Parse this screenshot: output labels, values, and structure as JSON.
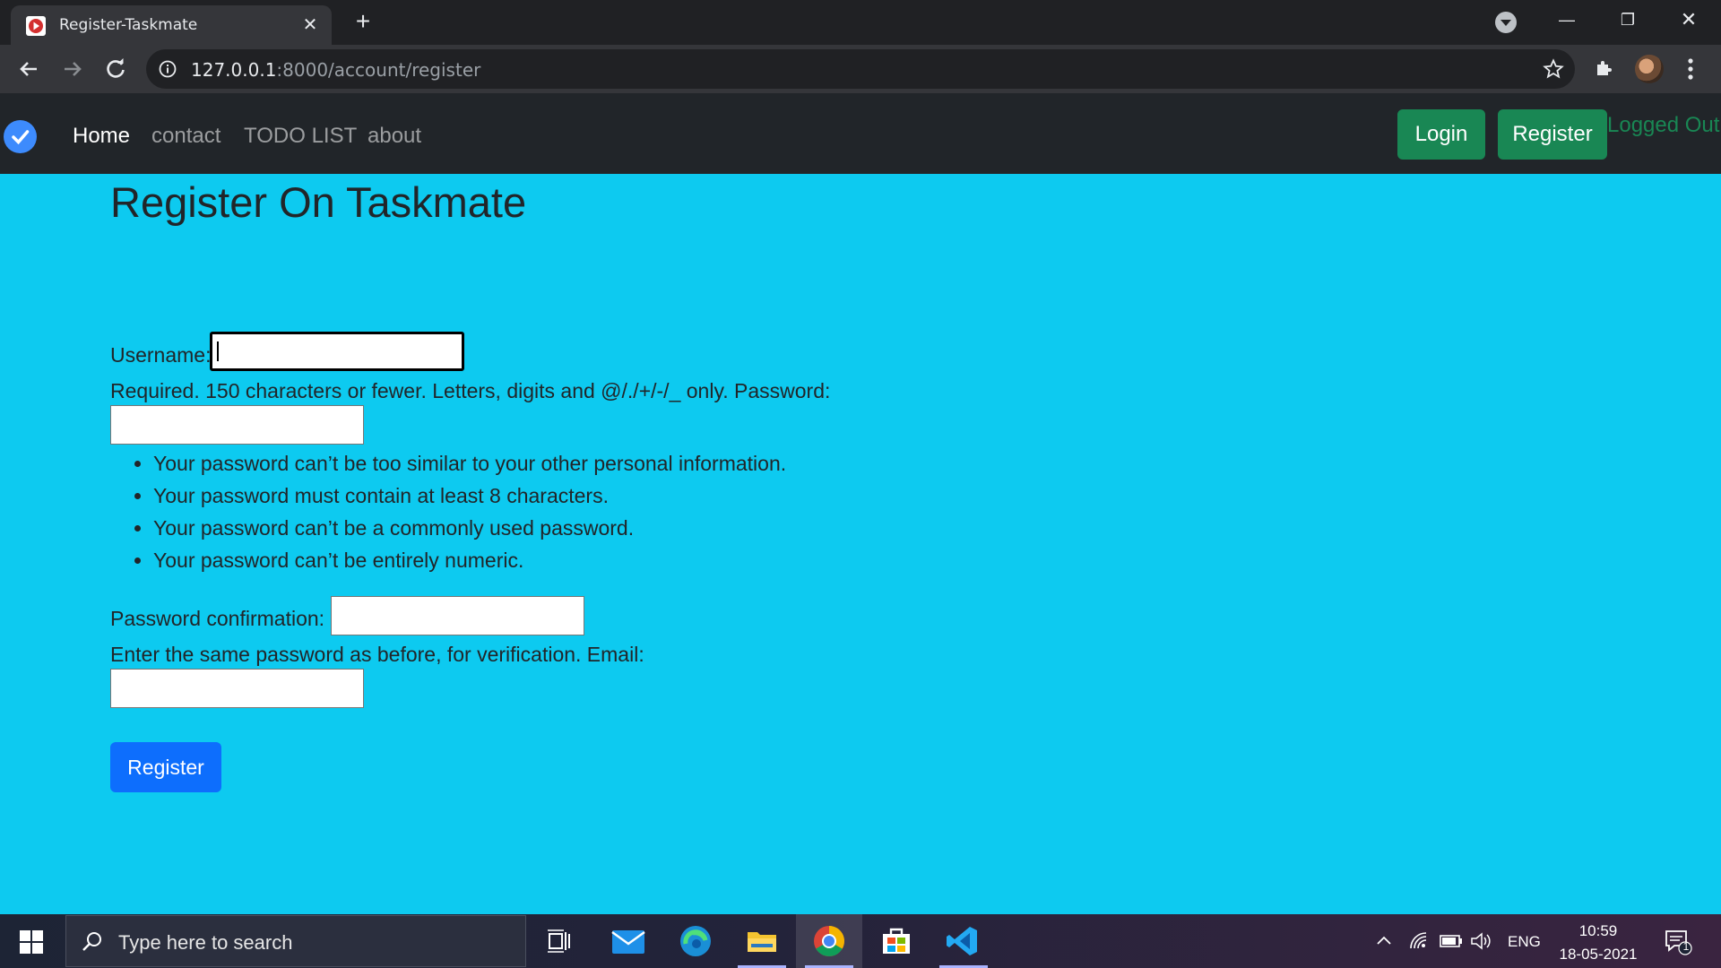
{
  "browser": {
    "tab_title": "Register-Taskmate",
    "url_host": "127.0.0.1",
    "url_path": ":8000/account/register"
  },
  "navbar": {
    "links": [
      "Home",
      "contact",
      "TODO LIST",
      "about"
    ],
    "login_label": "Login",
    "register_label": "Register",
    "status_text": "Logged Out"
  },
  "form": {
    "title": "Register On Taskmate",
    "username_label": "Username:",
    "username_help": "Required. 150 characters or fewer. Letters, digits and @/./+/-/_ only. Password:",
    "password_rules": [
      "Your password can’t be too similar to your other personal information.",
      "Your password must contain at least 8 characters.",
      "Your password can’t be a commonly used password.",
      "Your password can’t be entirely numeric."
    ],
    "password_confirm_label": "Password confirmation:",
    "confirm_help": "Enter the same password as before, for verification. Email:",
    "username_value": "",
    "password_value": "",
    "password_confirm_value": "",
    "email_value": "",
    "submit_label": "Register"
  },
  "taskbar": {
    "search_placeholder": "Type here to search",
    "language": "ENG",
    "time": "10:59",
    "date": "18-05-2021",
    "notification_count": "1"
  },
  "colors": {
    "page_bg": "#0dcaf0",
    "navbar_bg": "#212529",
    "success": "#198754",
    "primary": "#0d6efd"
  },
  "icons": [
    "browser-favicon",
    "close-icon",
    "plus-icon",
    "back-arrow-icon",
    "forward-arrow-icon",
    "reload-icon",
    "info-icon",
    "star-icon",
    "extensions-icon",
    "more-vert-icon",
    "checkmark-icon",
    "windows-logo-icon",
    "search-icon",
    "task-view-icon",
    "mail-icon",
    "edge-icon",
    "folder-icon",
    "chrome-icon",
    "store-icon",
    "vscode-icon",
    "chevron-up-icon",
    "wifi-icon",
    "battery-icon",
    "volume-icon",
    "notification-icon"
  ]
}
